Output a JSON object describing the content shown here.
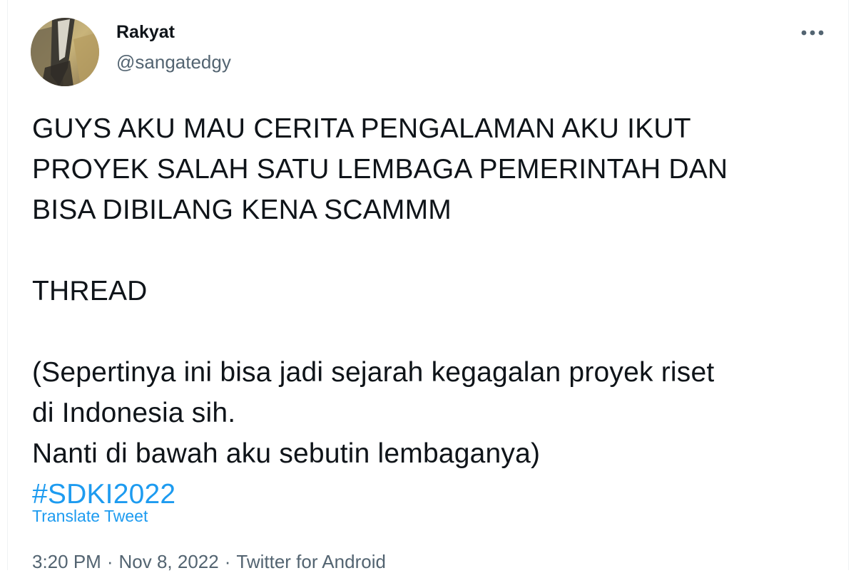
{
  "author": {
    "display_name": "Rakyat",
    "handle": "@sangatedgy"
  },
  "tweet": {
    "line1": "GUYS AKU MAU CERITA PENGALAMAN AKU IKUT",
    "line2": "PROYEK SALAH SATU LEMBAGA PEMERINTAH DAN",
    "line3": "BISA DIBILANG KENA SCAMMM",
    "line4": "THREAD",
    "line5": "(Sepertinya ini bisa jadi sejarah kegagalan proyek riset",
    "line6": "di Indonesia sih.",
    "line7": "Nanti di bawah aku sebutin lembaganya)",
    "hashtag": "#SDKI2022"
  },
  "translate_label": "Translate Tweet",
  "meta": {
    "time": "3:20 PM",
    "separator": "·",
    "date": "Nov 8, 2022",
    "source": "Twitter for Android"
  },
  "icons": {
    "more": "more-horizontal-icon",
    "avatar": "profile-avatar"
  },
  "colors": {
    "link": "#1d9bf0",
    "text": "#0f1419",
    "secondary": "#536471"
  }
}
